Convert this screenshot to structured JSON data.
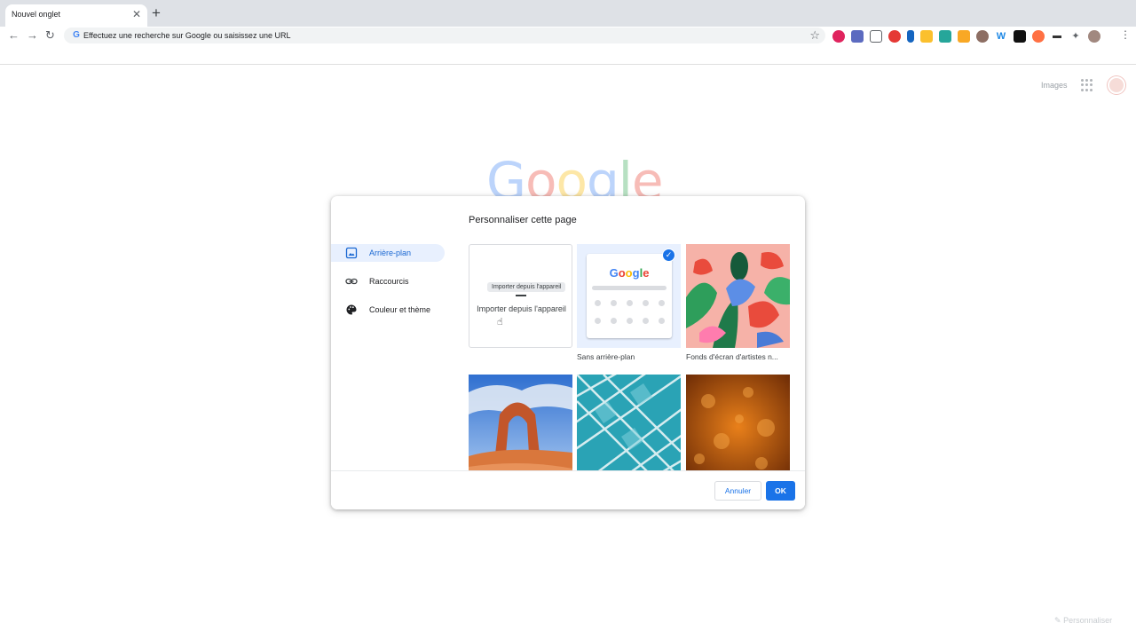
{
  "browser": {
    "tab_title": "Nouvel onglet",
    "omnibox_placeholder": "Effectuez une recherche sur Google ou saisissez une URL"
  },
  "ntp": {
    "images_link": "Images",
    "logo": [
      "G",
      "o",
      "o",
      "g",
      "l",
      "e"
    ],
    "customize_label": "Personnaliser"
  },
  "dialog": {
    "title": "Personnaliser cette page",
    "sidebar": [
      {
        "label": "Arrière-plan",
        "icon": "image-icon",
        "active": true
      },
      {
        "label": "Raccourcis",
        "icon": "link-icon",
        "active": false
      },
      {
        "label": "Couleur et thème",
        "icon": "palette-icon",
        "active": false
      }
    ],
    "tiles": {
      "upload_label": "Importer depuis l'appareil",
      "upload_tooltip": "Importer depuis l'appareil",
      "no_background_label": "Sans arrière-plan",
      "mini_logo": "Google",
      "artists_label": "Fonds d'écran d'artistes n..."
    },
    "cancel_label": "Annuler",
    "ok_label": "OK"
  }
}
